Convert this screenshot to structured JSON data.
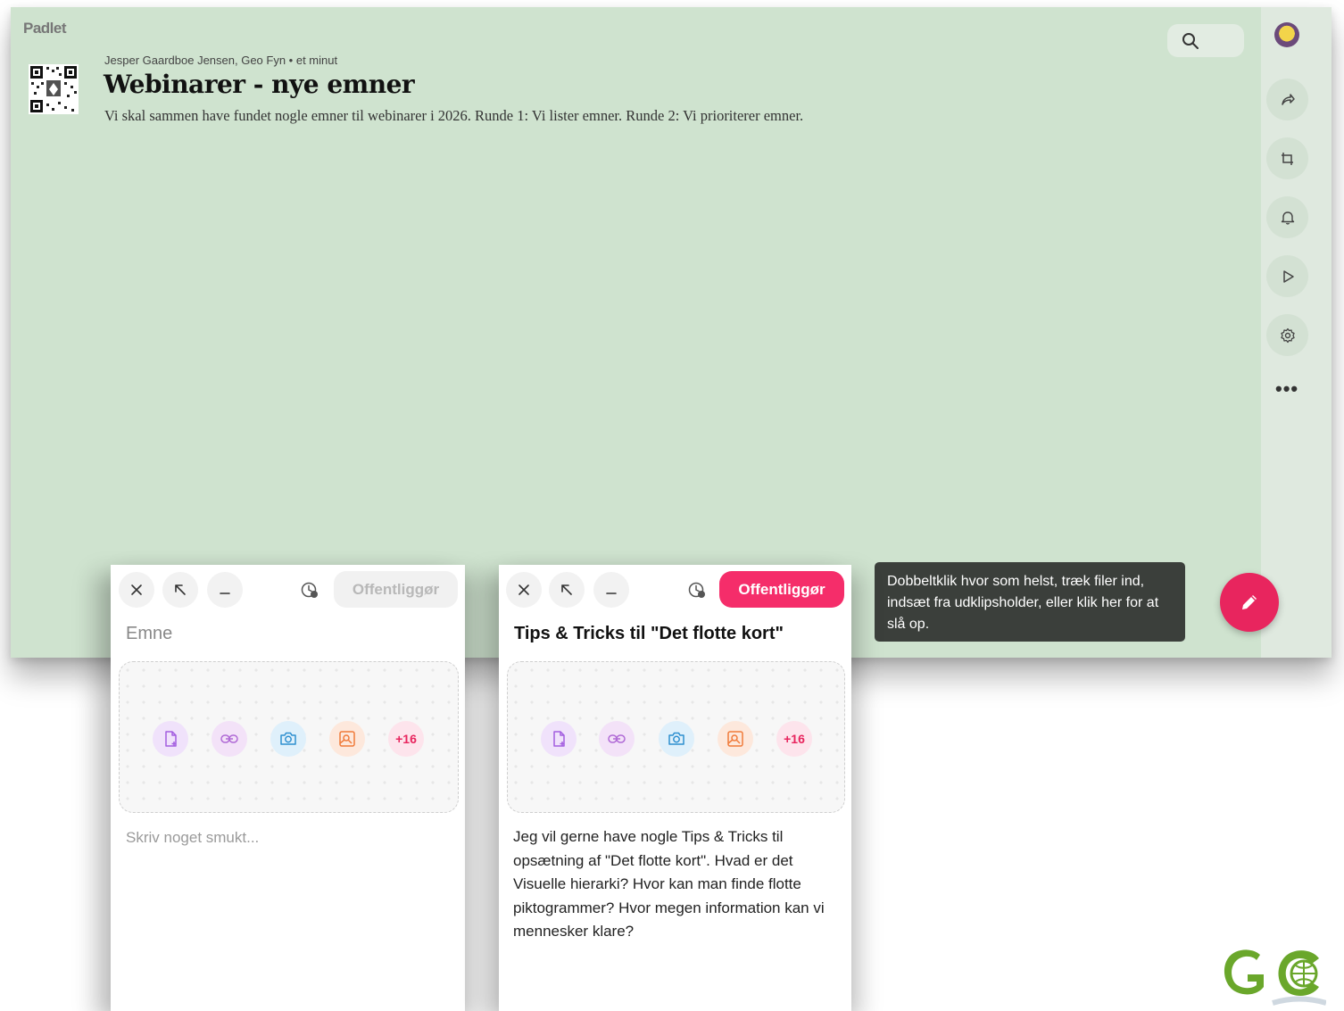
{
  "app": {
    "brand": "Padlet"
  },
  "board": {
    "meta": "Jesper Gaardboe Jensen, Geo Fyn • et minut",
    "title": "Webinarer - nye emner",
    "description": "Vi skal sammen have fundet nogle emner til webinarer i 2026. Runde 1: Vi lister emner. Runde 2: Vi prioriterer emner."
  },
  "search": {
    "icon": "search-icon"
  },
  "sidebar": {
    "buttons": [
      {
        "name": "share",
        "icon": "share-icon"
      },
      {
        "name": "remake",
        "icon": "remake-icon"
      },
      {
        "name": "notifications",
        "icon": "bell-icon"
      },
      {
        "name": "slideshow",
        "icon": "play-icon"
      },
      {
        "name": "settings",
        "icon": "gear-icon"
      },
      {
        "name": "more",
        "icon": "more-icon",
        "label": "•••"
      }
    ]
  },
  "tooltip": {
    "text": "Dobbeltklik hvor som helst, træk filer ind, indsæt fra udklipsholder, eller klik her for at slå op."
  },
  "composer_empty": {
    "publish_label": "Offentliggør",
    "subject_placeholder": "Emne",
    "body_placeholder": "Skriv noget smukt...",
    "more_attachments": "+16"
  },
  "composer_filled": {
    "publish_label": "Offentliggør",
    "subject": "Tips & Tricks til \"Det flotte kort\"",
    "body": "Jeg vil gerne have nogle Tips & Tricks til opsætning af \"Det flotte kort\". Hvad er det Visuelle hierarki? Hvor kan man finde flotte piktogrammer? Hvor megen information kan vi mennesker klare?",
    "more_attachments": "+16"
  },
  "colors": {
    "board_bg": "#cfe3cf",
    "accent": "#f52d6a",
    "fab": "#e8255e",
    "tooltip_bg": "#3b3f3b"
  }
}
